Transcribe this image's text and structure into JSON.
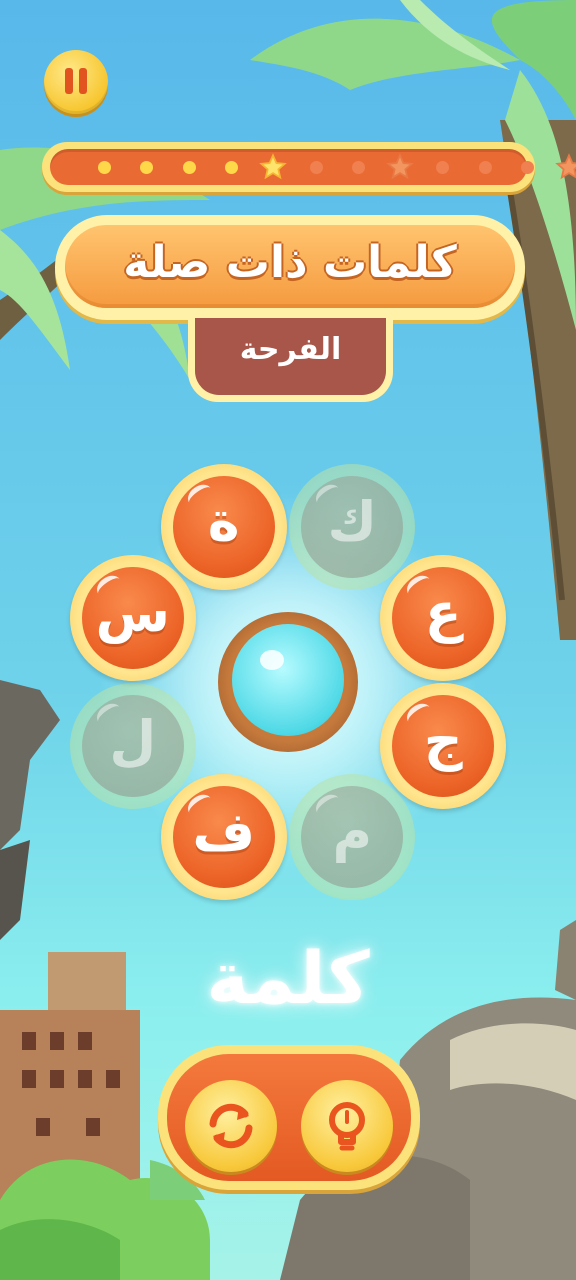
{
  "header": {
    "pause_icon": "pause-icon",
    "level_progress": {
      "completed": 4,
      "total": 12,
      "current_index": 5,
      "star_positions": [
        5,
        8,
        12
      ]
    }
  },
  "title": "كلمات ذات صلة",
  "category": "الفرحة",
  "letters": [
    {
      "char": "ك",
      "used": true
    },
    {
      "char": "ع",
      "used": false
    },
    {
      "char": "ج",
      "used": false
    },
    {
      "char": "م",
      "used": true
    },
    {
      "char": "ف",
      "used": false
    },
    {
      "char": "ل",
      "used": true
    },
    {
      "char": "س",
      "used": false
    },
    {
      "char": "ة",
      "used": false
    }
  ],
  "current_word": "كلمة",
  "controls": {
    "shuffle_icon": "shuffle-icon",
    "hint_icon": "hint-lightbulb-icon"
  },
  "colors": {
    "accent_orange": "#ec6327",
    "gold": "#f7c44c",
    "category_bg": "#a8564a"
  }
}
